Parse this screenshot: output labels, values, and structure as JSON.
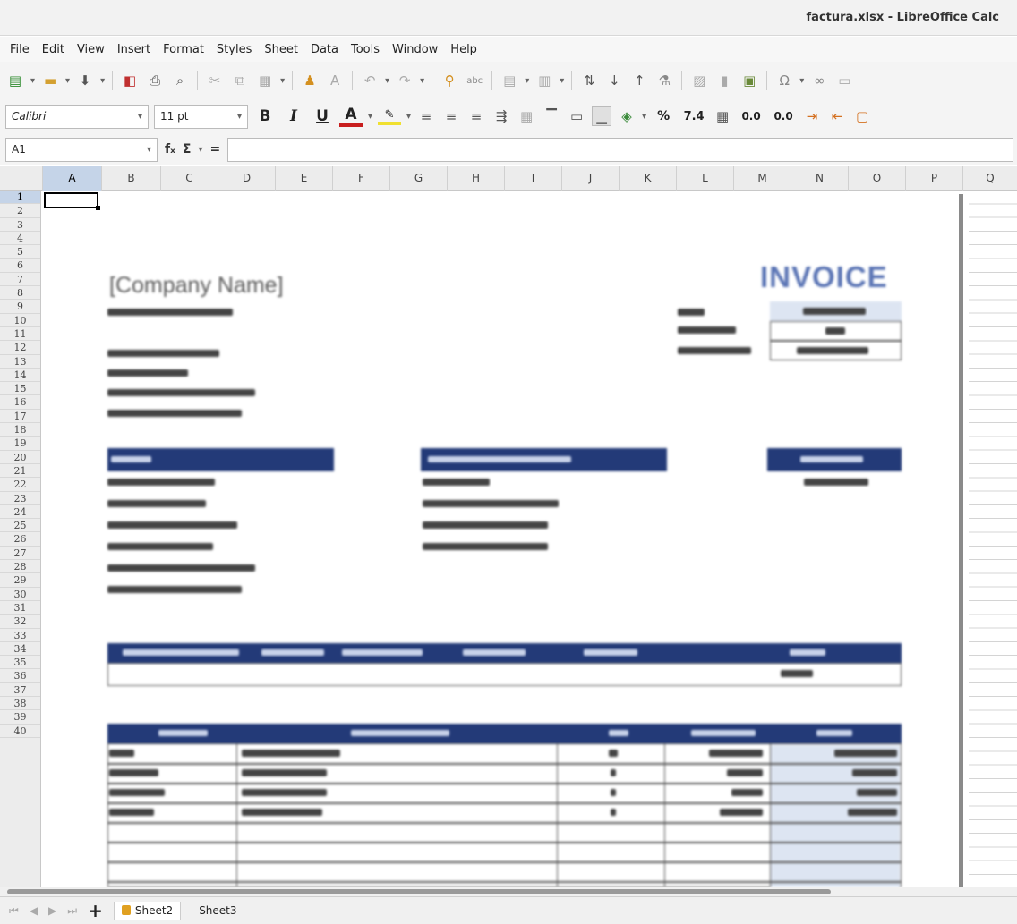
{
  "window": {
    "title": "factura.xlsx - LibreOffice Calc"
  },
  "menu": [
    "File",
    "Edit",
    "View",
    "Insert",
    "Format",
    "Styles",
    "Sheet",
    "Data",
    "Tools",
    "Window",
    "Help"
  ],
  "format_toolbar": {
    "font_name": "Calibri",
    "font_size": "11 pt",
    "bold": "B",
    "italic": "I",
    "underline": "U",
    "percent": "%",
    "number": "7.4",
    "dec_add": "0.0",
    "dec_del": "0.0"
  },
  "formula_bar": {
    "cell_ref": "A1",
    "fx": "fₓ",
    "sum": "Σ",
    "equals": "=",
    "value": ""
  },
  "columns": [
    "A",
    "B",
    "C",
    "D",
    "E",
    "F",
    "G",
    "H",
    "I",
    "J",
    "K",
    "L",
    "M",
    "N",
    "O",
    "P",
    "Q"
  ],
  "selected_column": "A",
  "rows": [
    "1",
    "2",
    "3",
    "4",
    "5",
    "6",
    "7",
    "8",
    "9",
    "10",
    "11",
    "12",
    "13",
    "14",
    "15",
    "16",
    "17",
    "18",
    "19",
    "20",
    "21",
    "22",
    "23",
    "24",
    "25",
    "26",
    "27",
    "28",
    "29",
    "30",
    "31",
    "32",
    "33",
    "34",
    "35",
    "36",
    "37",
    "38",
    "39",
    "40"
  ],
  "selected_row": "1",
  "invoice": {
    "company_name": "[Company Name]",
    "heading": "INVOICE"
  },
  "sheets": {
    "tabs": [
      "Sheet2",
      "Sheet3"
    ],
    "active": "Sheet2"
  },
  "colors": {
    "header_blue": "#233a78",
    "invoice_blue": "#5b75b5",
    "selection": "#c5d4e8"
  }
}
